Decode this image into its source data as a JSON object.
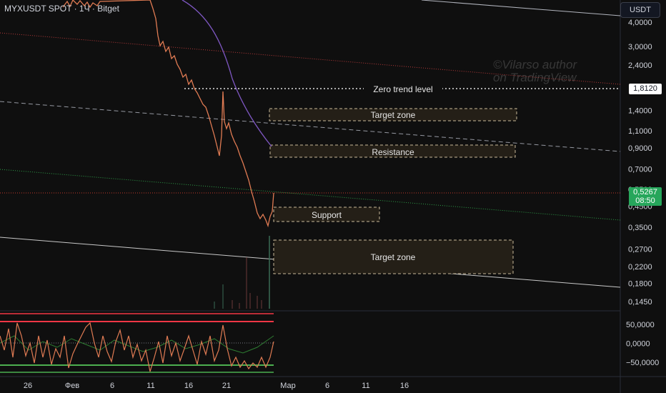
{
  "header": {
    "symbol": "MYXUSDT SPOT · 1Ч · Bitget",
    "currency_button": "USDT"
  },
  "watermark": {
    "line1": "©Vilarso author",
    "line2": "on TradingView"
  },
  "price_scale": {
    "ticks": [
      "4,0000",
      "3,0000",
      "2,4000",
      "1,4000",
      "1,1000",
      "0,9000",
      "0,7000",
      "0,5500",
      "0,4500",
      "0,3500",
      "0,2700",
      "0,2200",
      "0,1800",
      "0,1450"
    ],
    "values": [
      4.0,
      3.0,
      2.4,
      1.4,
      1.1,
      0.9,
      0.7,
      0.55,
      0.45,
      0.35,
      0.27,
      0.22,
      0.18,
      0.145
    ],
    "zero_trend_tag": "1,8120",
    "current_price": "0,5267",
    "countdown": "08:50"
  },
  "oscillator_scale": {
    "ticks": [
      "50,0000",
      "0,0000",
      "−50,0000"
    ],
    "values": [
      50,
      0,
      -50
    ]
  },
  "time_axis": {
    "labels": [
      "26",
      "Фев",
      "6",
      "11",
      "16",
      "21",
      "Мар",
      "6",
      "11",
      "16"
    ]
  },
  "annotations": {
    "zero_trend_level": "Zero trend level",
    "target_zone_upper": "Target zone",
    "resistance": "Resistance",
    "support": "Support",
    "target_zone_lower": "Target zone"
  },
  "colors": {
    "background": "#0f0f0f",
    "price_line": "#e07b53",
    "moving_average": "#7e57c2",
    "current_price": "#26a65b",
    "zone_border": "#c9b99a",
    "osc_upper": "#f23645",
    "osc_lower": "#4caf50"
  },
  "chart_data": {
    "type": "line",
    "scale": "log",
    "price_range": [
      0.12,
      4.8
    ],
    "x_range": [
      "26 Jan",
      "18 Mar"
    ],
    "series": [],
    "approx_price_path": [
      {
        "x": "30 Jan",
        "y": 4.3
      },
      {
        "x": "9 Feb",
        "y": 4.6
      },
      {
        "x": "11 Feb",
        "y": 3.1
      },
      {
        "x": "14 Feb",
        "y": 2.4
      },
      {
        "x": "17 Feb",
        "y": 1.5
      },
      {
        "x": "18 Feb",
        "y": 0.9
      },
      {
        "x": "20 Feb",
        "y": 1.8
      },
      {
        "x": "21 Feb",
        "y": 1.2
      },
      {
        "x": "23 Feb",
        "y": 0.8
      },
      {
        "x": "25 Feb",
        "y": 0.5
      },
      {
        "x": "26 Feb",
        "y": 0.38
      },
      {
        "x": "27 Feb",
        "y": 0.42
      },
      {
        "x": "27 Feb",
        "y": 0.5267
      }
    ],
    "zones": [
      {
        "label": "Zero trend level",
        "value": 1.812
      },
      {
        "label": "Target zone",
        "from": 1.2,
        "to": 1.45
      },
      {
        "label": "Resistance",
        "from": 0.78,
        "to": 0.92
      },
      {
        "label": "Support",
        "from": 0.37,
        "to": 0.44
      },
      {
        "label": "Target zone",
        "from": 0.19,
        "to": 0.3
      }
    ]
  }
}
